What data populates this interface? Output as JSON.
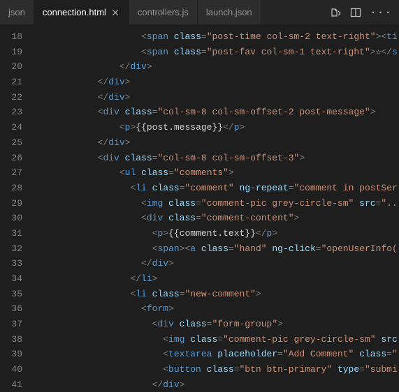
{
  "tabs": {
    "left_partial": "json",
    "active": "connection.html",
    "t2": "controllers.js",
    "t3": "launch.json"
  },
  "lines": {
    "start": 18,
    "count": 24
  },
  "code": {
    "l18": {
      "indent": 10,
      "tokens": [
        {
          "t": "pun",
          "v": "<"
        },
        {
          "t": "tagn",
          "v": "span"
        },
        {
          "t": "txt",
          "v": " "
        },
        {
          "t": "attr",
          "v": "class"
        },
        {
          "t": "pun",
          "v": "="
        },
        {
          "t": "str",
          "v": "\"post-time col-sm-2 text-right\""
        },
        {
          "t": "pun",
          "v": "><"
        },
        {
          "t": "tagn",
          "v": "ti"
        }
      ]
    },
    "l19": {
      "indent": 10,
      "tokens": [
        {
          "t": "pun",
          "v": "<"
        },
        {
          "t": "tagn",
          "v": "span"
        },
        {
          "t": "txt",
          "v": " "
        },
        {
          "t": "attr",
          "v": "class"
        },
        {
          "t": "pun",
          "v": "="
        },
        {
          "t": "str",
          "v": "\"post-fav col-sm-1 text-right\""
        },
        {
          "t": "pun",
          "v": ">"
        },
        {
          "t": "txt",
          "v": "☆"
        },
        {
          "t": "pun",
          "v": "</"
        },
        {
          "t": "tagn",
          "v": "s"
        }
      ]
    },
    "l20": {
      "indent": 8,
      "tokens": [
        {
          "t": "pun",
          "v": "</"
        },
        {
          "t": "tagn",
          "v": "div"
        },
        {
          "t": "pun",
          "v": ">"
        }
      ]
    },
    "l21": {
      "indent": 6,
      "tokens": [
        {
          "t": "pun",
          "v": "</"
        },
        {
          "t": "tagn",
          "v": "div"
        },
        {
          "t": "pun",
          "v": ">"
        }
      ]
    },
    "l22": {
      "indent": 6,
      "tokens": [
        {
          "t": "pun",
          "v": "</"
        },
        {
          "t": "tagn",
          "v": "div"
        },
        {
          "t": "pun",
          "v": ">"
        }
      ]
    },
    "l23": {
      "indent": 6,
      "tokens": [
        {
          "t": "pun",
          "v": "<"
        },
        {
          "t": "tagn",
          "v": "div"
        },
        {
          "t": "txt",
          "v": " "
        },
        {
          "t": "attr",
          "v": "class"
        },
        {
          "t": "pun",
          "v": "="
        },
        {
          "t": "str",
          "v": "\"col-sm-8 col-sm-offset-2 post-message\""
        },
        {
          "t": "pun",
          "v": ">"
        }
      ]
    },
    "l24": {
      "indent": 8,
      "tokens": [
        {
          "t": "pun",
          "v": "<"
        },
        {
          "t": "tagn",
          "v": "p"
        },
        {
          "t": "pun",
          "v": ">"
        },
        {
          "t": "txt",
          "v": "{{post.message}}"
        },
        {
          "t": "pun",
          "v": "</"
        },
        {
          "t": "tagn",
          "v": "p"
        },
        {
          "t": "pun",
          "v": ">"
        }
      ]
    },
    "l25": {
      "indent": 6,
      "tokens": [
        {
          "t": "pun",
          "v": "</"
        },
        {
          "t": "tagn",
          "v": "div"
        },
        {
          "t": "pun",
          "v": ">"
        }
      ]
    },
    "l26": {
      "indent": 6,
      "tokens": [
        {
          "t": "pun",
          "v": "<"
        },
        {
          "t": "tagn",
          "v": "div"
        },
        {
          "t": "txt",
          "v": " "
        },
        {
          "t": "attr",
          "v": "class"
        },
        {
          "t": "pun",
          "v": "="
        },
        {
          "t": "str",
          "v": "\"col-sm-8 col-sm-offset-3\""
        },
        {
          "t": "pun",
          "v": ">"
        }
      ]
    },
    "l27": {
      "indent": 8,
      "tokens": [
        {
          "t": "pun",
          "v": "<"
        },
        {
          "t": "tagn",
          "v": "ul"
        },
        {
          "t": "txt",
          "v": " "
        },
        {
          "t": "attr",
          "v": "class"
        },
        {
          "t": "pun",
          "v": "="
        },
        {
          "t": "str",
          "v": "\"comments\""
        },
        {
          "t": "pun",
          "v": ">"
        }
      ]
    },
    "l28": {
      "indent": 9,
      "tokens": [
        {
          "t": "pun",
          "v": "<"
        },
        {
          "t": "tagn",
          "v": "li"
        },
        {
          "t": "txt",
          "v": " "
        },
        {
          "t": "attr",
          "v": "class"
        },
        {
          "t": "pun",
          "v": "="
        },
        {
          "t": "str",
          "v": "\"comment\""
        },
        {
          "t": "txt",
          "v": " "
        },
        {
          "t": "attr",
          "v": "ng-repeat"
        },
        {
          "t": "pun",
          "v": "="
        },
        {
          "t": "str",
          "v": "\"comment in postSer"
        }
      ]
    },
    "l29": {
      "indent": 10,
      "tokens": [
        {
          "t": "pun",
          "v": "<"
        },
        {
          "t": "tagn",
          "v": "img"
        },
        {
          "t": "txt",
          "v": " "
        },
        {
          "t": "attr",
          "v": "class"
        },
        {
          "t": "pun",
          "v": "="
        },
        {
          "t": "str",
          "v": "\"comment-pic grey-circle-sm\""
        },
        {
          "t": "txt",
          "v": " "
        },
        {
          "t": "attr",
          "v": "src"
        },
        {
          "t": "pun",
          "v": "="
        },
        {
          "t": "str",
          "v": "\"..."
        }
      ]
    },
    "l30": {
      "indent": 10,
      "tokens": [
        {
          "t": "pun",
          "v": "<"
        },
        {
          "t": "tagn",
          "v": "div"
        },
        {
          "t": "txt",
          "v": " "
        },
        {
          "t": "attr",
          "v": "class"
        },
        {
          "t": "pun",
          "v": "="
        },
        {
          "t": "str",
          "v": "\"comment-content\""
        },
        {
          "t": "pun",
          "v": ">"
        }
      ]
    },
    "l31": {
      "indent": 11,
      "tokens": [
        {
          "t": "pun",
          "v": "<"
        },
        {
          "t": "tagn",
          "v": "p"
        },
        {
          "t": "pun",
          "v": ">"
        },
        {
          "t": "txt",
          "v": "{{comment.text}}"
        },
        {
          "t": "pun",
          "v": "</"
        },
        {
          "t": "tagn",
          "v": "p"
        },
        {
          "t": "pun",
          "v": ">"
        }
      ]
    },
    "l32": {
      "indent": 11,
      "tokens": [
        {
          "t": "pun",
          "v": "<"
        },
        {
          "t": "tagn",
          "v": "span"
        },
        {
          "t": "pun",
          "v": "><"
        },
        {
          "t": "tagn",
          "v": "a"
        },
        {
          "t": "txt",
          "v": " "
        },
        {
          "t": "attr",
          "v": "class"
        },
        {
          "t": "pun",
          "v": "="
        },
        {
          "t": "str",
          "v": "\"hand\""
        },
        {
          "t": "txt",
          "v": " "
        },
        {
          "t": "attr",
          "v": "ng-click"
        },
        {
          "t": "pun",
          "v": "="
        },
        {
          "t": "str",
          "v": "\"openUserInfo("
        }
      ]
    },
    "l33": {
      "indent": 10,
      "tokens": [
        {
          "t": "pun",
          "v": "</"
        },
        {
          "t": "tagn",
          "v": "div"
        },
        {
          "t": "pun",
          "v": ">"
        }
      ]
    },
    "l34": {
      "indent": 9,
      "tokens": [
        {
          "t": "pun",
          "v": "</"
        },
        {
          "t": "tagn",
          "v": "li"
        },
        {
          "t": "pun",
          "v": ">"
        }
      ]
    },
    "l35": {
      "indent": 9,
      "tokens": [
        {
          "t": "pun",
          "v": "<"
        },
        {
          "t": "tagn",
          "v": "li"
        },
        {
          "t": "txt",
          "v": " "
        },
        {
          "t": "attr",
          "v": "class"
        },
        {
          "t": "pun",
          "v": "="
        },
        {
          "t": "str",
          "v": "\"new-comment\""
        },
        {
          "t": "pun",
          "v": ">"
        }
      ]
    },
    "l36": {
      "indent": 10,
      "tokens": [
        {
          "t": "pun",
          "v": "<"
        },
        {
          "t": "tagn",
          "v": "form"
        },
        {
          "t": "pun",
          "v": ">"
        }
      ]
    },
    "l37": {
      "indent": 11,
      "tokens": [
        {
          "t": "pun",
          "v": "<"
        },
        {
          "t": "tagn",
          "v": "div"
        },
        {
          "t": "txt",
          "v": " "
        },
        {
          "t": "attr",
          "v": "class"
        },
        {
          "t": "pun",
          "v": "="
        },
        {
          "t": "str",
          "v": "\"form-group\""
        },
        {
          "t": "pun",
          "v": ">"
        }
      ]
    },
    "l38": {
      "indent": 12,
      "tokens": [
        {
          "t": "pun",
          "v": "<"
        },
        {
          "t": "tagn",
          "v": "img"
        },
        {
          "t": "txt",
          "v": " "
        },
        {
          "t": "attr",
          "v": "class"
        },
        {
          "t": "pun",
          "v": "="
        },
        {
          "t": "str",
          "v": "\"comment-pic grey-circle-sm\""
        },
        {
          "t": "txt",
          "v": " "
        },
        {
          "t": "attr",
          "v": "src"
        }
      ]
    },
    "l39": {
      "indent": 12,
      "tokens": [
        {
          "t": "pun",
          "v": "<"
        },
        {
          "t": "tagn",
          "v": "textarea"
        },
        {
          "t": "txt",
          "v": " "
        },
        {
          "t": "attr",
          "v": "placeholder"
        },
        {
          "t": "pun",
          "v": "="
        },
        {
          "t": "str",
          "v": "\"Add Comment\""
        },
        {
          "t": "txt",
          "v": " "
        },
        {
          "t": "attr",
          "v": "class"
        },
        {
          "t": "pun",
          "v": "="
        },
        {
          "t": "str",
          "v": "\""
        }
      ]
    },
    "l40": {
      "indent": 12,
      "tokens": [
        {
          "t": "pun",
          "v": "<"
        },
        {
          "t": "tagn",
          "v": "button"
        },
        {
          "t": "txt",
          "v": " "
        },
        {
          "t": "attr",
          "v": "class"
        },
        {
          "t": "pun",
          "v": "="
        },
        {
          "t": "str",
          "v": "\"btn btn-primary\""
        },
        {
          "t": "txt",
          "v": " "
        },
        {
          "t": "attr",
          "v": "type"
        },
        {
          "t": "pun",
          "v": "="
        },
        {
          "t": "str",
          "v": "\"submi"
        }
      ]
    },
    "l41": {
      "indent": 11,
      "tokens": [
        {
          "t": "pun",
          "v": "</"
        },
        {
          "t": "tagn",
          "v": "div"
        },
        {
          "t": "pun",
          "v": ">"
        }
      ]
    }
  }
}
